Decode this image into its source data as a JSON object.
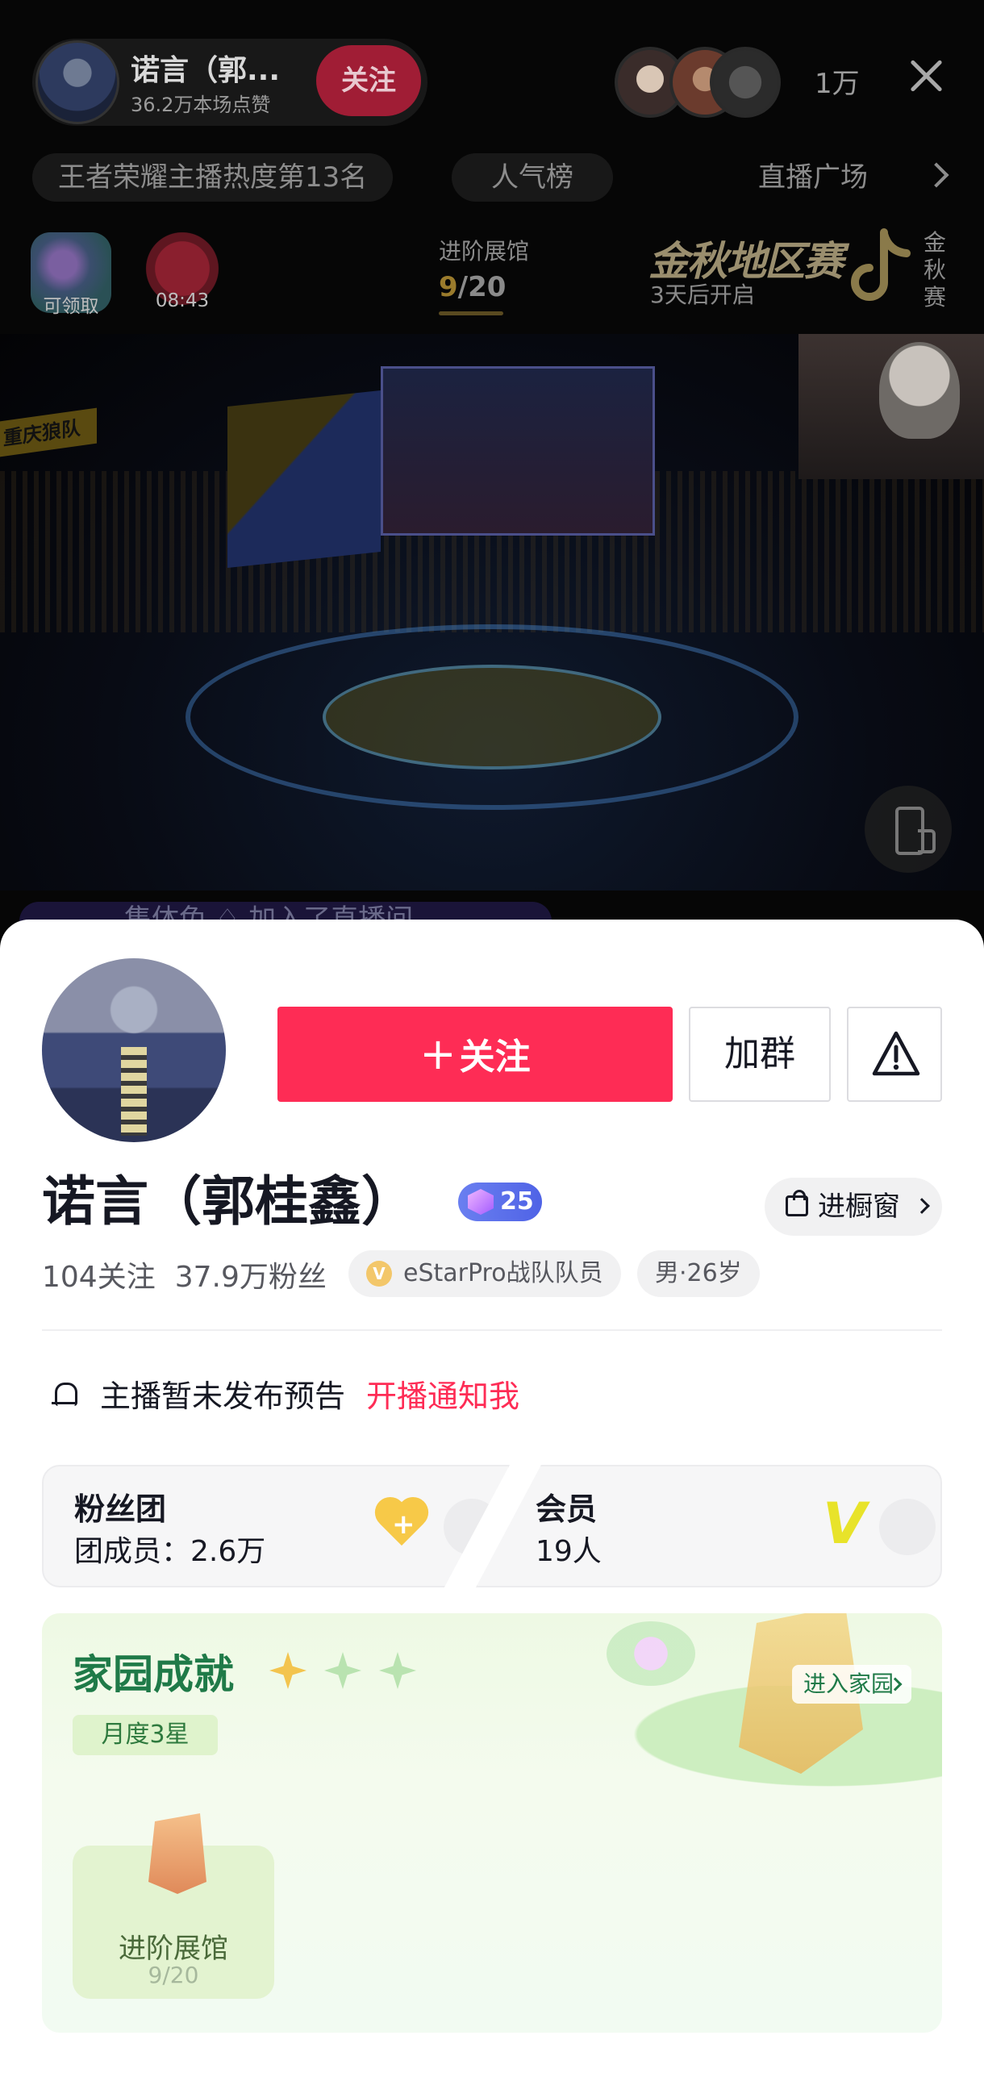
{
  "header": {
    "host_name": "诺言（郭...",
    "likes": "36.2万本场点赞",
    "follow_label": "关注",
    "viewer_count": "1万"
  },
  "rank_bar": {
    "rank_text": "王者荣耀主播热度第13名",
    "popularity": "人气榜",
    "plaza": "直播广场"
  },
  "widgets": {
    "claim_label": "可领取",
    "bag_timer": "08:43",
    "exhibition_title": "进阶展馆",
    "exhibition_current": "9",
    "exhibition_total": "/20",
    "exhibition_progress": 0.45,
    "autumn_title": "金秋地区赛",
    "autumn_sub": "3天后开启",
    "autumn_vertical": "金秋赛"
  },
  "stage": {
    "team_tag": "重庆狼队"
  },
  "chat_peek": "集体兔 ♢ 加入了直播间",
  "profile": {
    "follow_label": "关注",
    "group_label": "加群",
    "name": "诺言（郭桂鑫）",
    "level": "25",
    "showcase_label": "进橱窗",
    "following": "104关注",
    "fans": "37.9万粉丝",
    "team_tag": "eStarPro战队队员",
    "team_icon": "V",
    "gender_age": "男·26岁"
  },
  "notice": {
    "text": "主播暂未发布预告",
    "link": "开播通知我"
  },
  "fan_club": {
    "title": "粉丝团",
    "members": "团成员：2.6万"
  },
  "membership": {
    "title": "会员",
    "count": "19人"
  },
  "home": {
    "title": "家园成就",
    "enter_label": "进入家园",
    "level_label": "月度3星",
    "achievement_name": "进阶展馆",
    "achievement_progress": "9/20"
  },
  "colors": {
    "primary": "#fe2c55",
    "home_green": "#1f7a48",
    "level_badge": "#5b6ff0"
  }
}
